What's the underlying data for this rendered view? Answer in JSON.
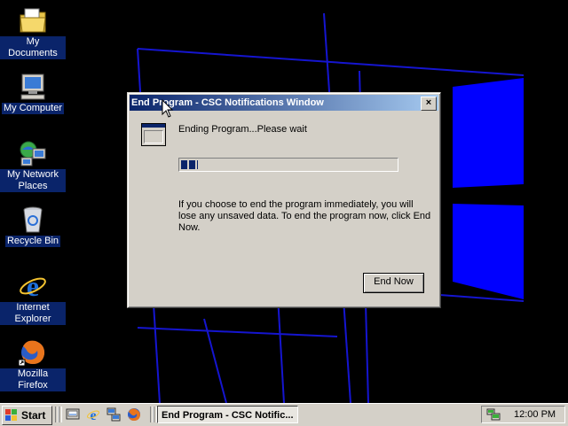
{
  "desktop": {
    "icons": [
      {
        "label": "My Documents",
        "icon": "folder-documents-icon"
      },
      {
        "label": "My Computer",
        "icon": "computer-icon"
      },
      {
        "label": "My Network Places",
        "icon": "network-places-icon"
      },
      {
        "label": "Recycle Bin",
        "icon": "recycle-bin-icon"
      },
      {
        "label": "Internet Explorer",
        "icon": "internet-explorer-icon"
      },
      {
        "label": "Mozilla Firefox",
        "icon": "firefox-icon"
      }
    ]
  },
  "dialog": {
    "title": "End Program - CSC Notifications Window",
    "close_label": "×",
    "status": "Ending Program...Please wait",
    "progress_fraction": 0.08,
    "message": "If you choose to end the program immediately, you will lose any unsaved data. To end the program now, click End Now.",
    "end_now_label": "End Now"
  },
  "taskbar": {
    "start_label": "Start",
    "quick_launch": [
      "show-desktop-icon",
      "internet-explorer-icon",
      "network-icon",
      "firefox-icon"
    ],
    "task_label": "End Program - CSC Notific...",
    "clock": "12:00 PM",
    "tray_icon": "network-tray-icon"
  },
  "colors": {
    "titlebar_start": "#0a246a",
    "titlebar_end": "#a6caf0",
    "desktop_bg": "#000000",
    "wallpaper_accent": "#0000ff",
    "window_face": "#d4d0c8"
  }
}
